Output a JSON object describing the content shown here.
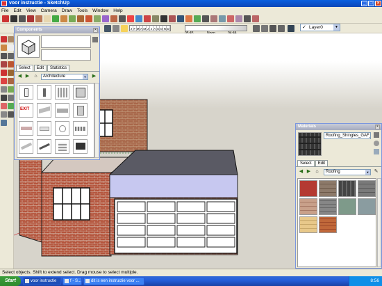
{
  "window": {
    "title": "voor instructie - SketchUp"
  },
  "menu": [
    "File",
    "Edit",
    "View",
    "Camera",
    "Draw",
    "Tools",
    "Window",
    "Help"
  ],
  "shadows": {
    "months": [
      "J",
      "F",
      "M",
      "A",
      "M",
      "J",
      "J",
      "A",
      "S",
      "O",
      "N",
      "D"
    ],
    "time_start": "05:45",
    "time_mid": "Noon",
    "time_end": "04:44"
  },
  "layer": {
    "current": "Layer0"
  },
  "components_panel": {
    "title": "Components",
    "tabs": [
      "Select",
      "Edit",
      "Statistics"
    ],
    "collection": "Architecture",
    "exit_label": "EXIT"
  },
  "materials_panel": {
    "title": "Materials",
    "material_name": "Roofing_Shingles_GAF_",
    "tabs": [
      "Select",
      "Edit"
    ],
    "library": "Roofing"
  },
  "status": {
    "text": "Select objects. Shift to extend select. Drag mouse to select multiple."
  },
  "taskbar": {
    "start": "Start",
    "tasks": [
      "voor instructie",
      "f - S...",
      "dit is een instructie voor ..."
    ],
    "clock": "8:56"
  },
  "colors": {
    "titlebar": "#0b4fcc",
    "brick": "#b5553d",
    "wall_top": "#c7c8f0",
    "roof": "#5a5a64"
  }
}
